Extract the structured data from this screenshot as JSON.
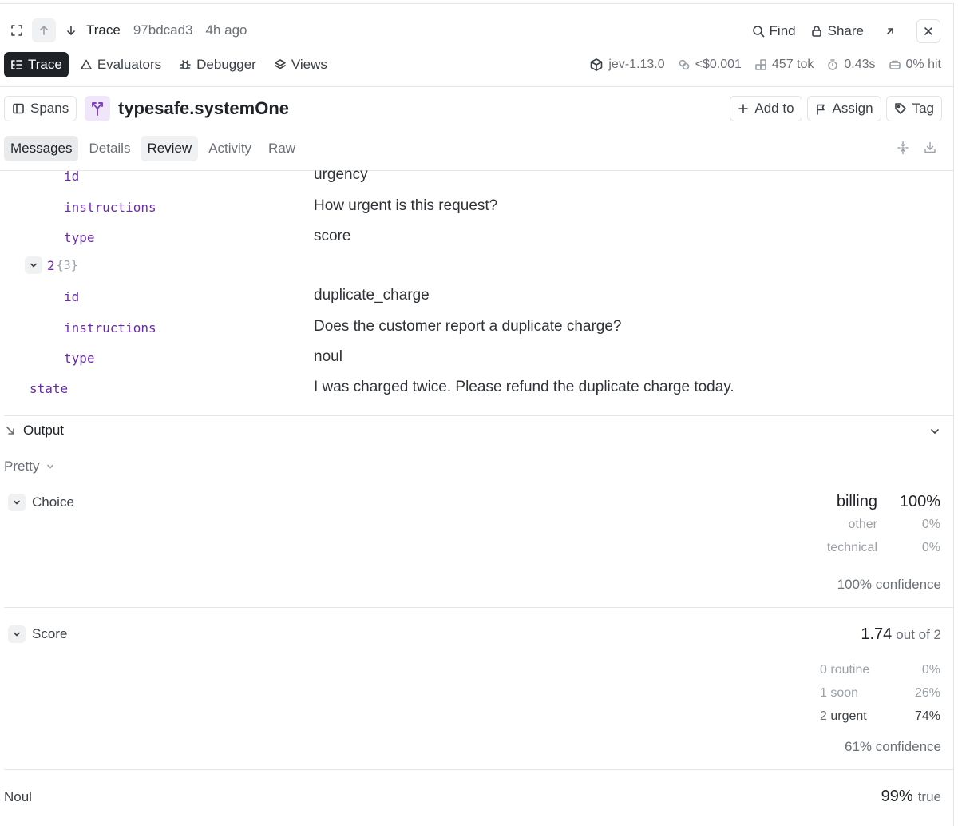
{
  "header": {
    "trace_label": "Trace",
    "trace_id": "97bdcad3",
    "time_ago": "4h ago",
    "find_label": "Find",
    "share_label": "Share"
  },
  "nav": {
    "tabs": [
      {
        "label": "Trace",
        "icon": "list-tree-icon"
      },
      {
        "label": "Evaluators",
        "icon": "triangle-icon"
      },
      {
        "label": "Debugger",
        "icon": "bug-icon"
      },
      {
        "label": "Views",
        "icon": "layers-icon"
      }
    ],
    "stats": {
      "version": "jev-1.13.0",
      "cost": "<$0.001",
      "tokens": "457 tok",
      "latency": "0.43s",
      "cache_hit": "0% hit"
    }
  },
  "span": {
    "spans_label": "Spans",
    "title": "typesafe.systemOne",
    "actions": [
      "Add to",
      "Assign",
      "Tag"
    ]
  },
  "message_tabs": [
    "Messages",
    "Details",
    "Review",
    "Activity",
    "Raw"
  ],
  "input": {
    "rows": [
      {
        "key": "id",
        "value": "urgency"
      },
      {
        "key": "instructions",
        "value": "How urgent is this request?"
      },
      {
        "key": "type",
        "value": "score"
      }
    ],
    "group": {
      "index": "2",
      "count": "{3}"
    },
    "group_rows": [
      {
        "key": "id",
        "value": "duplicate_charge"
      },
      {
        "key": "instructions",
        "value": "Does the customer report a duplicate charge?"
      },
      {
        "key": "type",
        "value": "noul"
      }
    ],
    "state": {
      "key": "state",
      "value": "I was charged twice. Please refund the duplicate charge today."
    }
  },
  "output": {
    "section_label": "Output",
    "format": "Pretty",
    "choice": {
      "label": "Choice",
      "top": {
        "label": "billing",
        "pct": "100%"
      },
      "others": [
        {
          "label": "other",
          "pct": "0%"
        },
        {
          "label": "technical",
          "pct": "0%"
        }
      ],
      "confidence": "100% confidence"
    },
    "score": {
      "label": "Score",
      "value": "1.74",
      "out_of": "out of 2",
      "levels": [
        {
          "num": "0",
          "label": "routine",
          "pct": "0%"
        },
        {
          "num": "1",
          "label": "soon",
          "pct": "26%"
        },
        {
          "num": "2",
          "label": "urgent",
          "pct": "74%"
        }
      ],
      "confidence": "61% confidence"
    },
    "noul": {
      "label": "Noul",
      "pct": "99%",
      "value": "true"
    }
  },
  "colors": {
    "key_purple": "#6a2ba8",
    "dark_pill": "#1f2328",
    "span_icon_bg": "#efe6fa",
    "span_icon": "#7b3fc4"
  }
}
